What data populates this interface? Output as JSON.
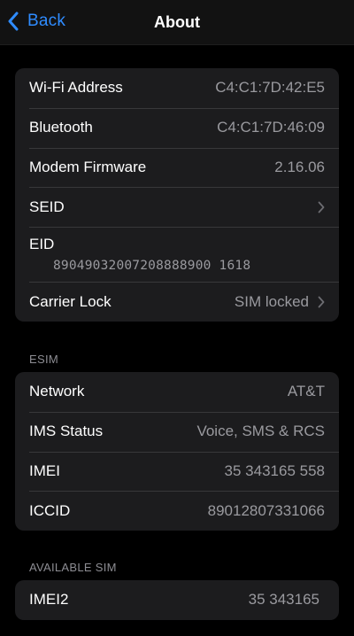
{
  "nav": {
    "back_label": "Back",
    "title": "About"
  },
  "device": {
    "rows": [
      {
        "label": "Wi-Fi Address",
        "value": "C4:C1:7D:42:E5"
      },
      {
        "label": "Bluetooth",
        "value": "C4:C1:7D:46:09"
      },
      {
        "label": "Modem Firmware",
        "value": "2.16.06"
      },
      {
        "label": "SEID",
        "value": ""
      },
      {
        "label": "EID",
        "value": "89049032007208888900 1618"
      },
      {
        "label": "Carrier Lock",
        "value": "SIM locked"
      }
    ]
  },
  "esim": {
    "header": "ESIM",
    "rows": [
      {
        "label": "Network",
        "value": "AT&T"
      },
      {
        "label": "IMS Status",
        "value": "Voice, SMS & RCS"
      },
      {
        "label": "IMEI",
        "value": "35 343165 558"
      },
      {
        "label": "ICCID",
        "value": "89012807331066"
      }
    ]
  },
  "available_sim": {
    "header": "AVAILABLE SIM",
    "rows": [
      {
        "label": "IMEI2",
        "value": "35 343165"
      }
    ]
  },
  "colors": {
    "accent": "#2f8cff",
    "background": "#000000",
    "cell": "#1c1c1e",
    "secondary_text": "#9a9a9f"
  },
  "icons": {
    "back": "chevron-left-icon",
    "disclosure": "chevron-right-icon"
  }
}
